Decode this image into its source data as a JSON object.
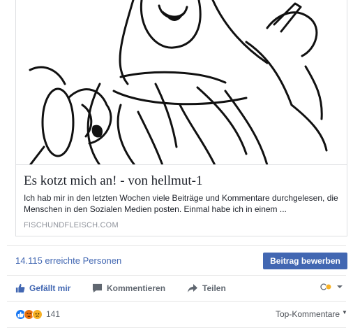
{
  "link_preview": {
    "image_alt": "Illustration of a shouting man",
    "title": "Es kotzt mich an! - von hellmut-1",
    "description": "Ich hab mir in den letzten Wochen viele Beiträge und Kommentare durchgelesen, die Menschen in den Sozialen Medien posten. Einmal habe ich in einem ...",
    "domain": "FISCHUNDFLEISCH.COM"
  },
  "reach": {
    "text": "14.115 erreichte Personen",
    "boost_label": "Beitrag bewerben"
  },
  "actions": {
    "like_label": "Gefällt mir",
    "comment_label": "Kommentieren",
    "share_label": "Teilen"
  },
  "reactions": {
    "types": [
      "like",
      "angry",
      "sad"
    ],
    "count": "141"
  },
  "comments_filter": {
    "label": "Top-Kommentare"
  },
  "colors": {
    "brand_blue": "#4267b2",
    "muted_text": "#606770",
    "like_reaction": "#1877f2",
    "angry_reaction": "#e9710f",
    "sad_reaction": "#f7b125"
  }
}
